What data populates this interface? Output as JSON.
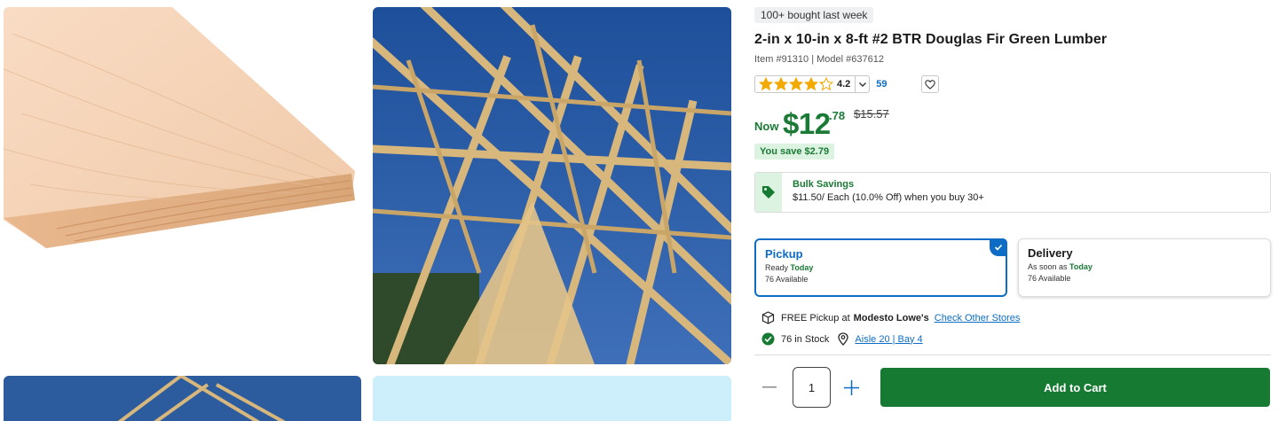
{
  "gallery": {
    "images": [
      {
        "depicts": "board-lumber"
      },
      {
        "depicts": "roof-trusses"
      },
      {
        "depicts": "roof-trusses-thumbnail"
      },
      {
        "depicts": "sky-thumbnail"
      }
    ]
  },
  "product": {
    "badge": "100+ bought last week",
    "title": "2-in x 10-in x 8-ft #2 BTR Douglas Fir Green Lumber",
    "meta": "Item #91310 | Model #637612",
    "rating": {
      "value": "4.2",
      "stars": 4.2,
      "max_stars": 5,
      "review_count": "59",
      "star_color": "#f2a900"
    },
    "price": {
      "now_label": "Now",
      "dollars": "$12",
      "cents": ".78",
      "was": "$15.57",
      "save": "You save $2.79"
    },
    "bulk": {
      "title": "Bulk Savings",
      "description": "$11.50/ Each (10.0% Off) when you buy 30+"
    },
    "fulfillment": {
      "pickup": {
        "title": "Pickup",
        "ready_label": "Ready",
        "ready_when": "Today",
        "available": "76 Available",
        "selected": true
      },
      "delivery": {
        "title": "Delivery",
        "eta_label": "As soon as",
        "eta_when": "Today",
        "available": "76 Available",
        "selected": false
      }
    },
    "pickup_info": {
      "free_label": "FREE Pickup at",
      "store": "Modesto Lowe's",
      "check_link": "Check Other Stores"
    },
    "stock": {
      "label": "76 in Stock",
      "aisle": "Aisle 20 | Bay 4"
    },
    "quantity": "1",
    "add_to_cart": "Add to Cart"
  },
  "colors": {
    "brand_green": "#1a7a36",
    "link_blue": "#0d6dc4",
    "button_green": "#167a33"
  },
  "icons": [
    "star-icon",
    "chevron-down-icon",
    "heart-icon",
    "price-tag-icon",
    "check-icon",
    "box-icon",
    "check-circle-icon",
    "map-pin-icon",
    "minus-icon",
    "plus-icon"
  ]
}
